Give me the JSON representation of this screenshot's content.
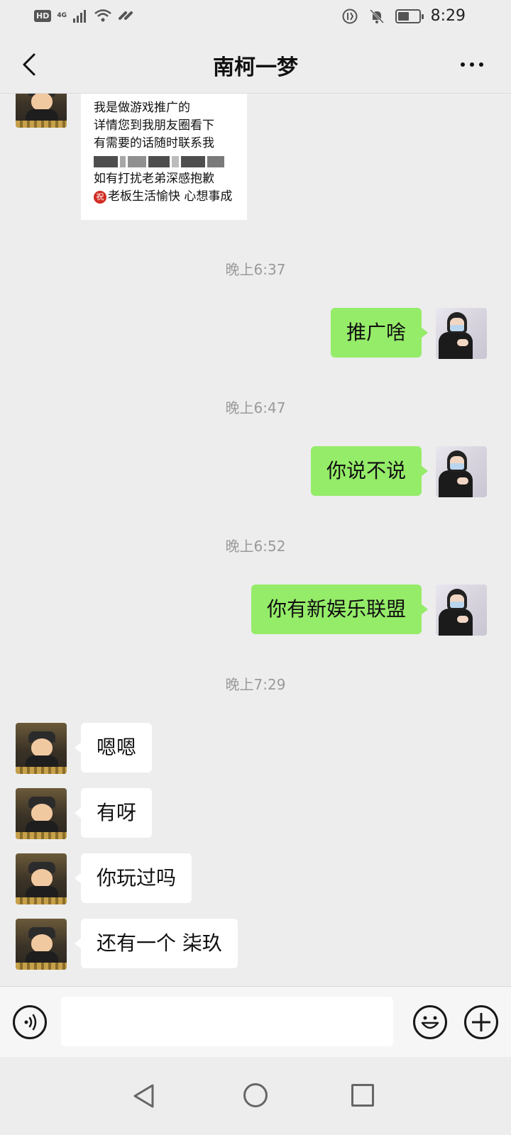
{
  "status_bar": {
    "hd": "HD",
    "network": "4G",
    "time": "8:29",
    "battery_level": 0.55
  },
  "header": {
    "title": "南柯一梦"
  },
  "messages": {
    "long_message_lines": [
      "我是做游戏推广的",
      "详情您到我朋友圈看下",
      "有需要的话随时联系我",
      "如有打扰老弟深感抱歉",
      "老板生活愉快 心想事成"
    ],
    "zhu_icon_text": "祝",
    "times": [
      "晚上6:37",
      "晚上6:47",
      "晚上6:52",
      "晚上7:29"
    ],
    "outgoing": [
      "推广啥",
      "你说不说",
      "你有新娱乐联盟"
    ],
    "incoming": [
      "嗯嗯",
      "有呀",
      "你玩过吗",
      "还有一个 柒玖"
    ]
  },
  "input_bar": {
    "placeholder": ""
  },
  "colors": {
    "background": "#ededed",
    "outgoing_bubble": "#95ec69",
    "incoming_bubble": "#ffffff",
    "timestamp": "#9a9a9a"
  },
  "icons": [
    "back-icon",
    "more-icon",
    "voice-icon",
    "emoji-icon",
    "plus-icon",
    "nav-back-icon",
    "nav-home-icon",
    "nav-recent-icon"
  ]
}
